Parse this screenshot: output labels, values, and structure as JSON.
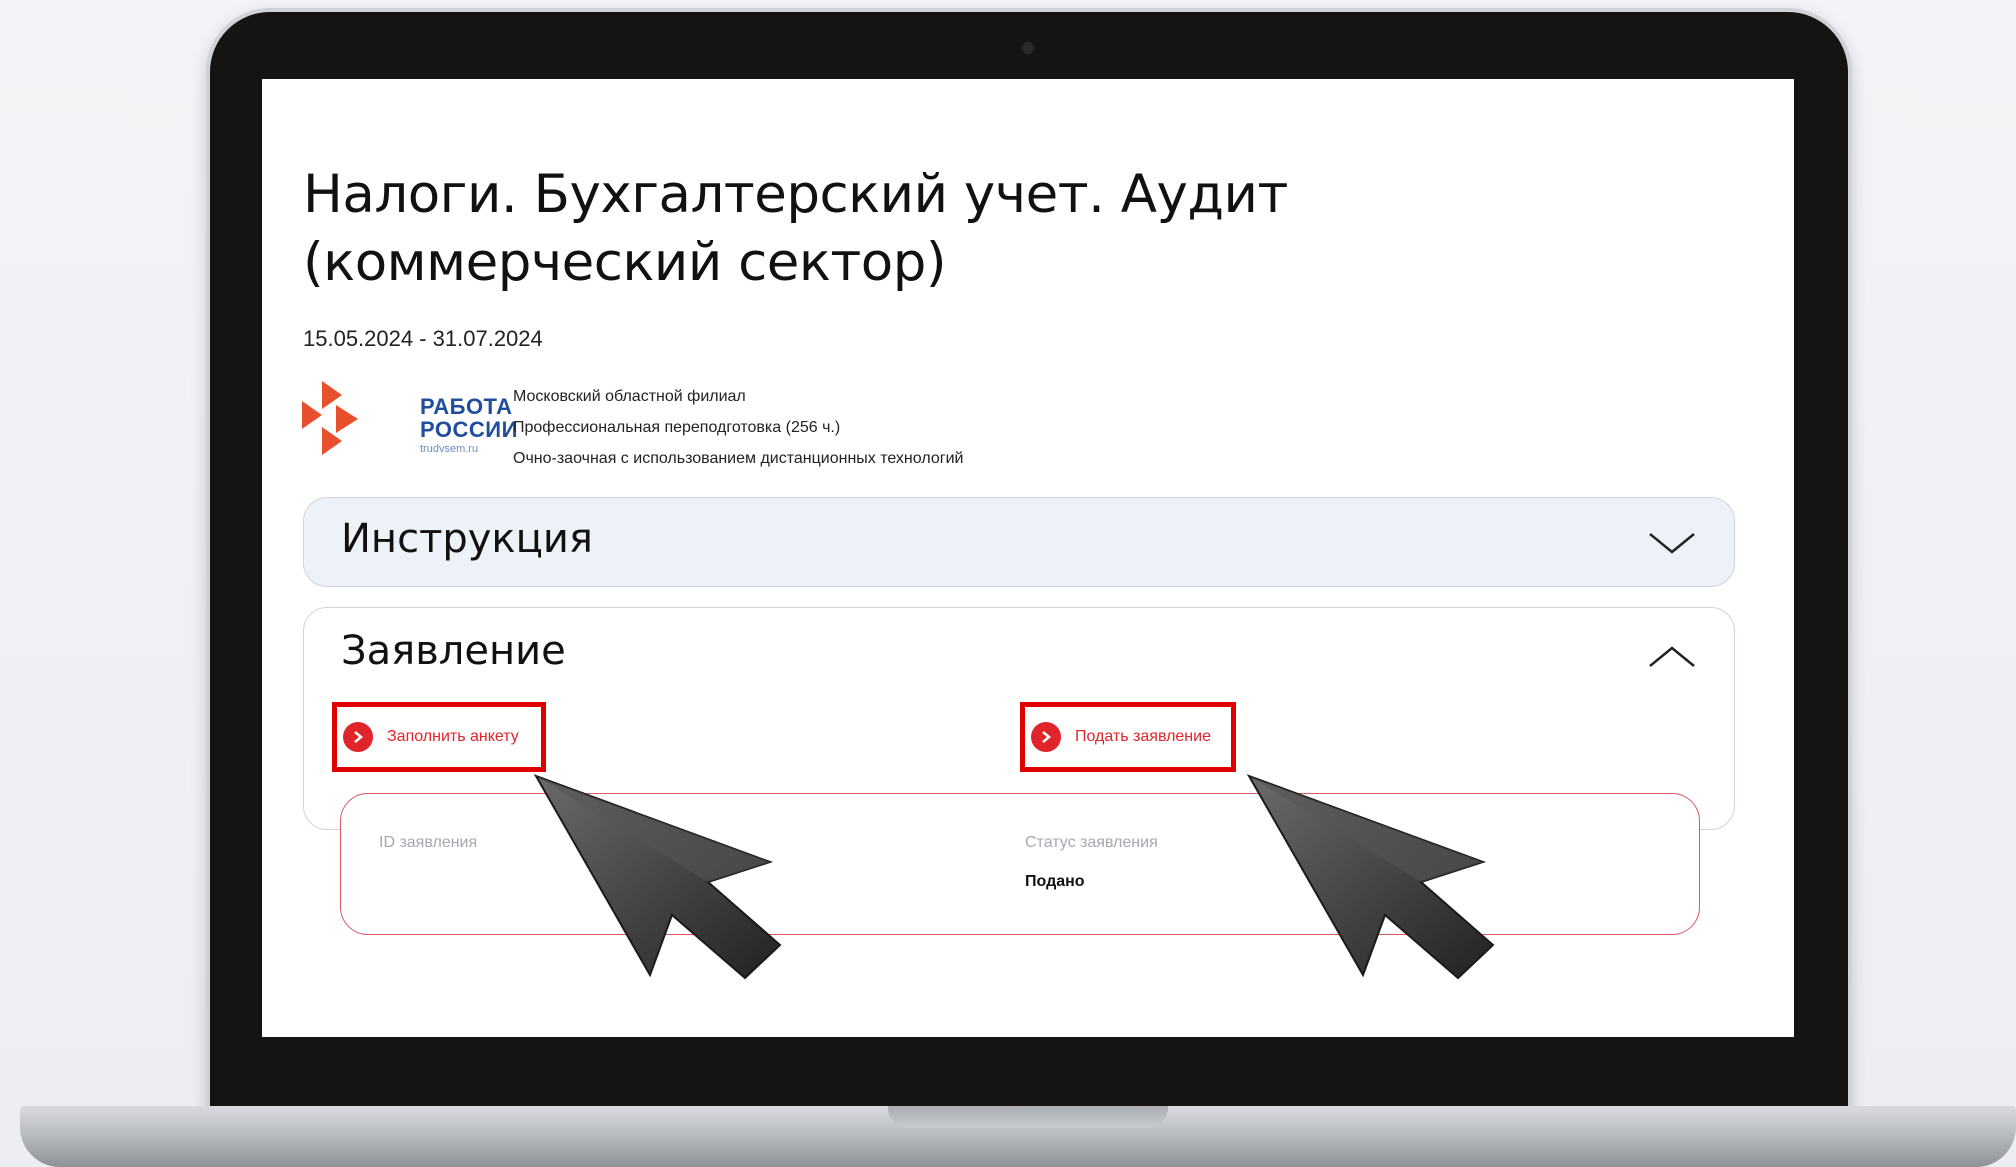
{
  "page": {
    "title": "Налоги. Бухгалтерский учет. Аудит (коммерческий сектор)",
    "dates": "15.05.2024 - 31.07.2024"
  },
  "logo": {
    "line1": "РАБОТА",
    "line2": "РОССИИ",
    "domain": "trudvsem.ru"
  },
  "meta": {
    "branch": "Московский областной филиал",
    "program": "Профессиональная переподготовка (256 ч.)",
    "format": "Очно-заочная с использованием дистанционных технологий"
  },
  "accordion": {
    "instruction": {
      "label": "Инструкция",
      "state": "collapsed",
      "icon": "chevron-down-icon"
    },
    "application": {
      "label": "Заявление",
      "state": "expanded",
      "icon": "chevron-up-icon"
    }
  },
  "actions": {
    "fill_form_label": "Заполнить анкету",
    "submit_label": "Подать заявление"
  },
  "status": {
    "id_label": "ID заявления",
    "id_value": "",
    "status_label": "Статус заявления",
    "status_value": "Подано"
  },
  "colors": {
    "accent_red": "#e0242b",
    "highlight_red": "#e00000",
    "logo_blue": "#1f4e9c",
    "logo_orange": "#e8502d",
    "instruction_bg": "#edf1f8"
  }
}
